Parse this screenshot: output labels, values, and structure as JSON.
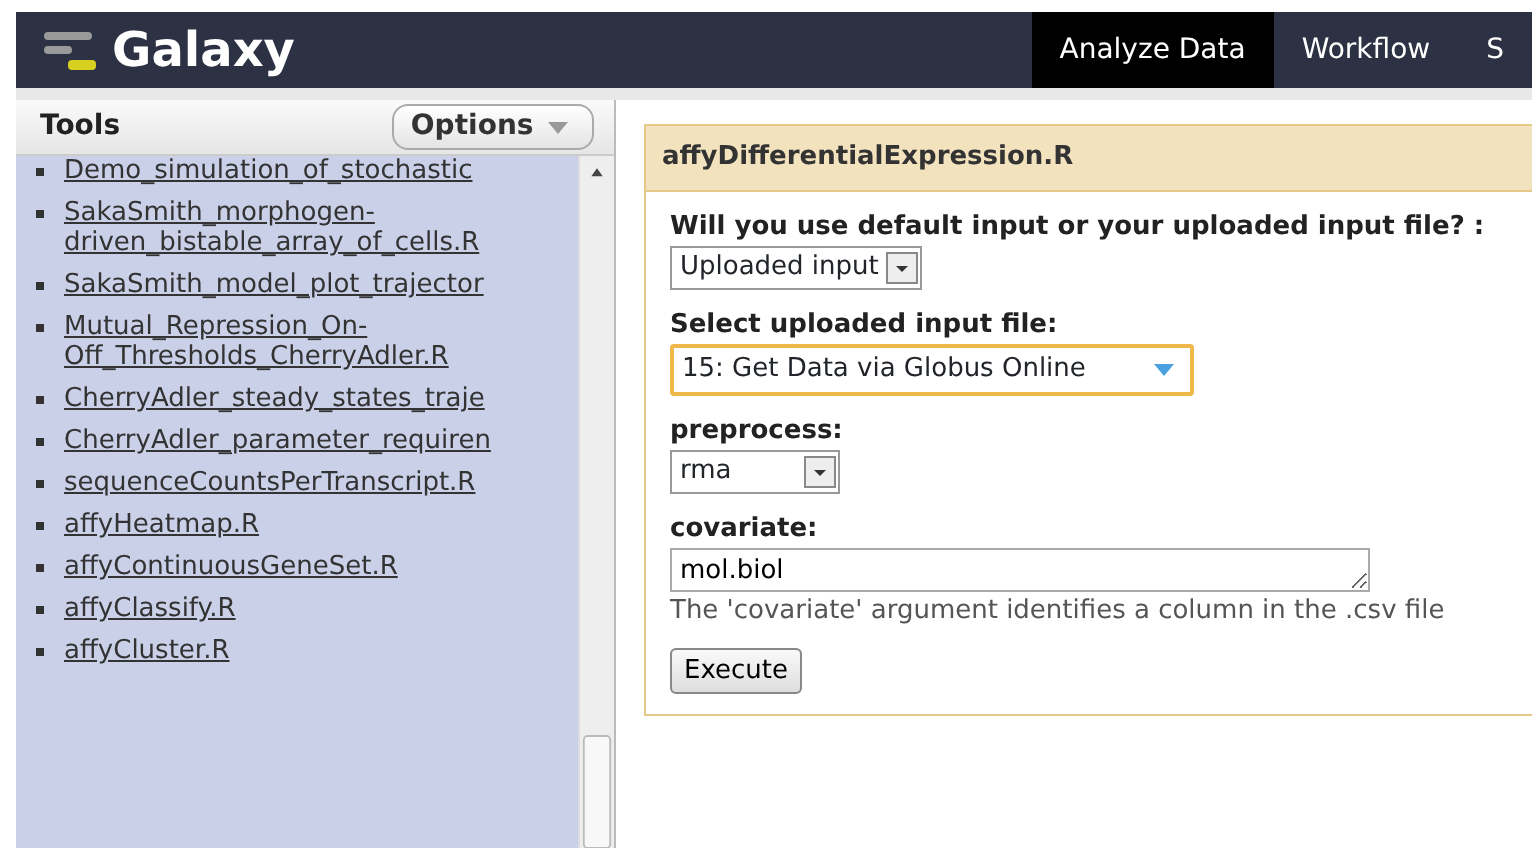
{
  "masthead": {
    "brand": "Galaxy",
    "tabs": [
      {
        "label": "Analyze Data",
        "selected": true
      },
      {
        "label": "Workflow",
        "selected": false
      },
      {
        "label": "S",
        "selected": false
      }
    ]
  },
  "tool_panel": {
    "title": "Tools",
    "options_button": "Options",
    "tools": [
      {
        "label": "Demo_simulation_of_stochastic"
      },
      {
        "label": "SakaSmith_morphogen-driven_bistable_array_of_cells.R"
      },
      {
        "label": "SakaSmith_model_plot_trajector"
      },
      {
        "label": "Mutual_Repression_On-Off_Thresholds_CherryAdler.R"
      },
      {
        "label": "CherryAdler_steady_states_traje"
      },
      {
        "label": "CherryAdler_parameter_requiren"
      },
      {
        "label": "sequenceCountsPerTranscript.R"
      },
      {
        "label": "affyHeatmap.R"
      },
      {
        "label": "affyContinuousGeneSet.R"
      },
      {
        "label": "affyClassify.R"
      },
      {
        "label": "affyCluster.R"
      }
    ]
  },
  "tool_form": {
    "title": "affyDifferentialExpression.R",
    "params": [
      {
        "kind": "select",
        "label": "Will you use default input or your uploaded input file? :",
        "value": "Uploaded input",
        "focused": false
      },
      {
        "kind": "select",
        "label": "Select uploaded input file:",
        "value": "15: Get Data via Globus Online",
        "focused": true
      },
      {
        "kind": "select",
        "label": "preprocess:",
        "value": "rma",
        "focused": false
      },
      {
        "kind": "textarea",
        "label": "covariate:",
        "value": "mol.biol",
        "help": "The 'covariate' argument identifies a column in the .csv file"
      }
    ],
    "execute_button": "Execute"
  }
}
